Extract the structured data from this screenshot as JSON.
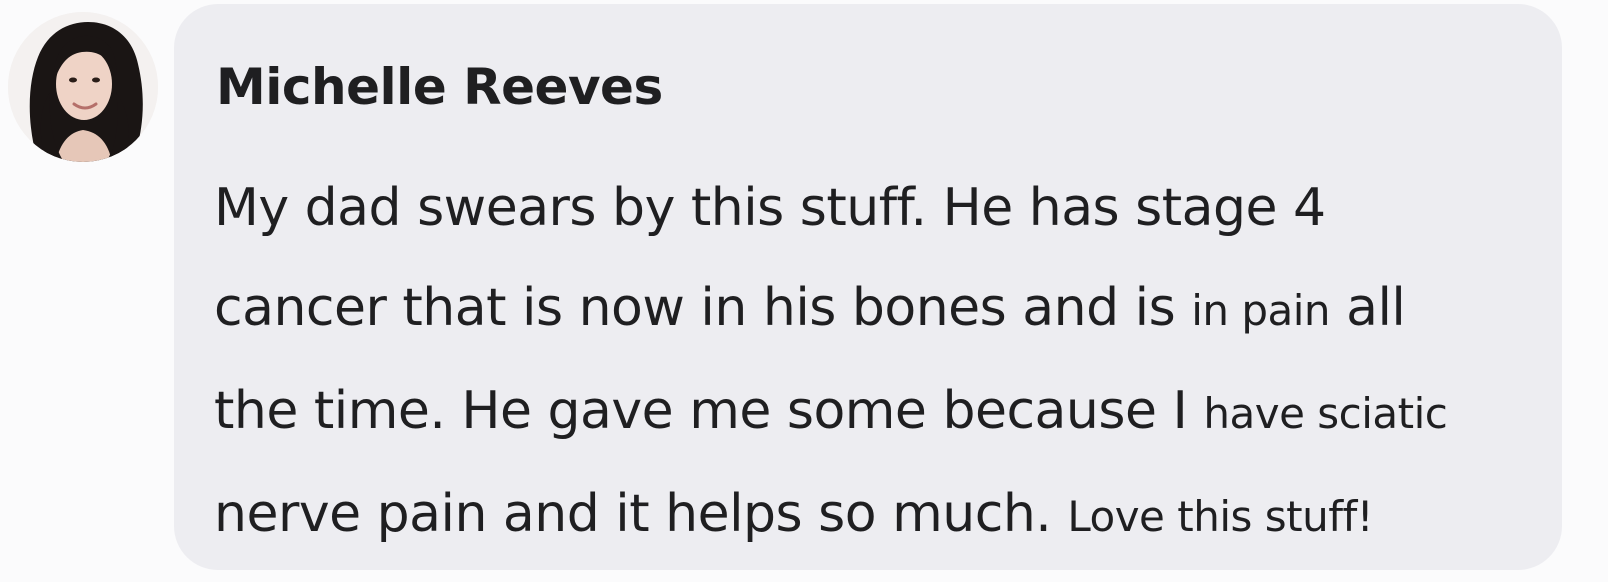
{
  "comment": {
    "author": "Michelle Reeves",
    "avatar_icon": "profile-photo",
    "lines": [
      [
        {
          "text": "My dad swears by this stuff. He has stage 4",
          "small": false
        }
      ],
      [
        {
          "text": "cancer that is now in his bones and is ",
          "small": false
        },
        {
          "text": "in pain",
          "small": true
        },
        {
          "text": " all",
          "small": false
        }
      ],
      [
        {
          "text": "the time. He gave me some because I ",
          "small": false
        },
        {
          "text": "have sciatic",
          "small": true
        }
      ],
      [
        {
          "text": "nerve pain and it helps so much. ",
          "small": false
        },
        {
          "text": "Love this stuff!",
          "small": true
        }
      ]
    ]
  },
  "colors": {
    "page_background": "#fbfbfc",
    "bubble_background": "#ededf1",
    "text": "#1f1f21"
  }
}
